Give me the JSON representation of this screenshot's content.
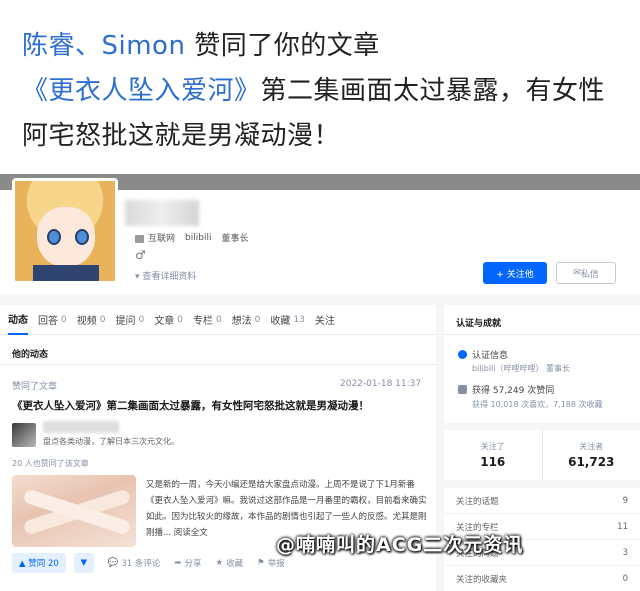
{
  "notice": {
    "who": "陈睿、Simon",
    "verb": " 赞同了你的文章 ",
    "article": "《更衣人坠入爱河》",
    "rest": "第二集画面太过暴露，有女性阿宅怒批这就是男凝动漫！"
  },
  "profile": {
    "tags": [
      "互联网",
      "bilibili",
      "董事长"
    ],
    "gender_icon": "♂",
    "detail_link": "查看详细资料",
    "follow_label": "+ 关注他",
    "message_label": "私信"
  },
  "tabs": [
    {
      "label": "动态",
      "count": ""
    },
    {
      "label": "回答",
      "count": "0"
    },
    {
      "label": "视频",
      "count": "0"
    },
    {
      "label": "提问",
      "count": "0"
    },
    {
      "label": "文章",
      "count": "0"
    },
    {
      "label": "专栏",
      "count": "0"
    },
    {
      "label": "想法",
      "count": "0"
    },
    {
      "label": "收藏",
      "count": "13"
    },
    {
      "label": "关注",
      "count": ""
    }
  ],
  "feed": {
    "section_title": "他的动态",
    "action": "赞同了文章",
    "time": "2022-01-18 11:37",
    "title": "《更衣人坠入爱河》第二集画面太过暴露，有女性阿宅怒批这就是男凝动漫！",
    "author_bio": "盘点各类动漫，了解日本三次元文化。",
    "agree_count": "20 人也赞同了该文章",
    "excerpt": "又是新的一周，今天小编还是给大家盘点动漫。上周不是说了下1月新番《更衣人坠入爱河》嘛。我说过这部作品是一月番里的霸权，目前看来确实如此。因为比较火的缘故，本作品的剧情也引起了一些人的反感。尤其是刚刚播... 阅读全文",
    "vote_up": "▲ 赞同 20",
    "vote_down": "▼",
    "comments": "31 条评论",
    "share": "分享",
    "favorite": "收藏",
    "report": "举报"
  },
  "sidebar": {
    "title": "认证与成就",
    "cert_label": "认证信息",
    "cert_sub": "bilibili（哔哩哔哩） 董事长",
    "praise": "获得 57,249 次赞同",
    "praise_sub": "获得 10,018 次喜欢，7,188 次收藏",
    "following_label": "关注了",
    "following_num": "116",
    "followers_label": "关注者",
    "followers_num": "61,723",
    "rows": [
      {
        "label": "关注的话题",
        "count": "9"
      },
      {
        "label": "关注的专栏",
        "count": "11"
      },
      {
        "label": "关注的问题",
        "count": "3"
      },
      {
        "label": "关注的收藏夹",
        "count": "0"
      }
    ]
  },
  "watermark": "@喃喃叫的ACG二次元资讯"
}
